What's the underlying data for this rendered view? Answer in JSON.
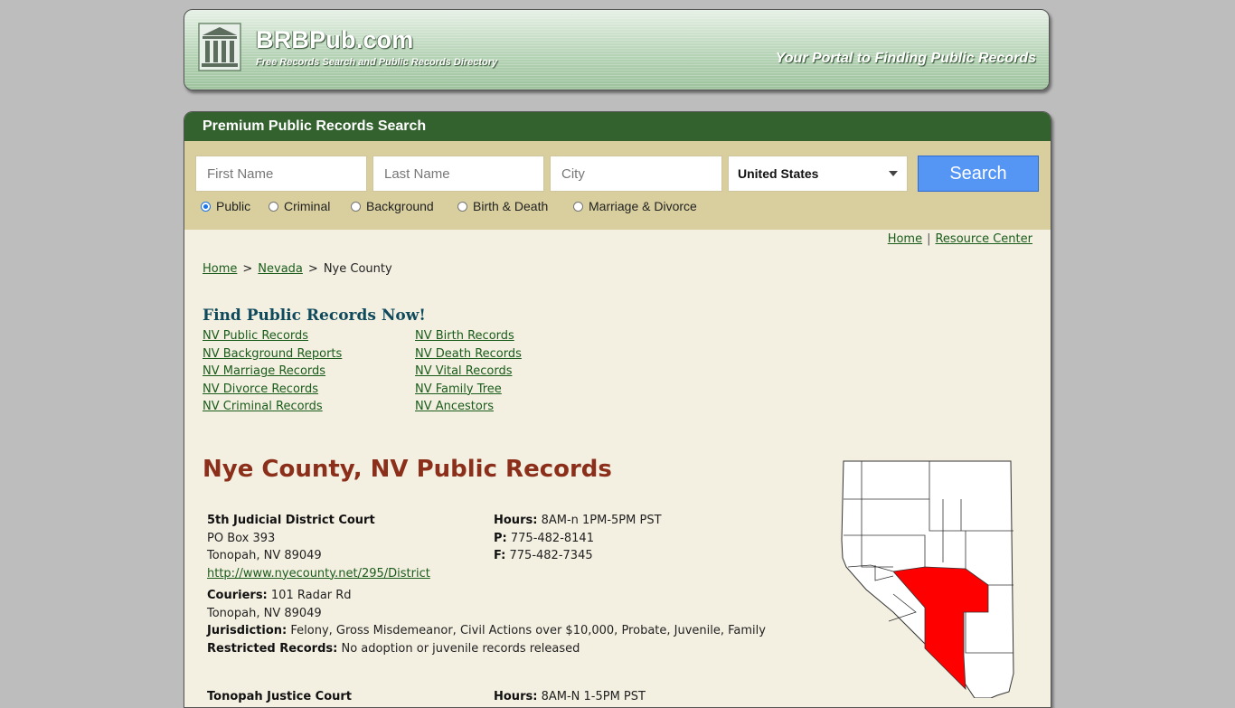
{
  "header": {
    "site_name": "BRBPub.com",
    "tagline": "Free Records Search and Public Records Directory",
    "slogan": "Your Portal to Finding Public Records"
  },
  "search": {
    "title": "Premium Public Records Search",
    "first_name_placeholder": "First Name",
    "last_name_placeholder": "Last Name",
    "city_placeholder": "City",
    "country_selected": "United States",
    "button_label": "Search",
    "record_types": [
      {
        "label": "Public",
        "selected": true
      },
      {
        "label": "Criminal",
        "selected": false
      },
      {
        "label": "Background",
        "selected": false
      },
      {
        "label": "Birth & Death",
        "selected": false
      },
      {
        "label": "Marriage & Divorce",
        "selected": false
      }
    ]
  },
  "top_links": {
    "home": "Home",
    "separator": "|",
    "resource_center": "Resource Center"
  },
  "breadcrumb": {
    "home": "Home",
    "state": "Nevada",
    "current": "Nye County",
    "separator": ">"
  },
  "find_records": {
    "title": "Find Public Records Now!",
    "left_links": [
      "NV Public Records",
      "NV Background Reports",
      "NV Marriage Records",
      "NV Divorce Records",
      "NV Criminal Records"
    ],
    "right_links": [
      "NV Birth Records",
      "NV Death Records",
      "NV Vital Records",
      "NV Family Tree",
      "NV Ancestors"
    ]
  },
  "county": {
    "title": "Nye County, NV Public Records",
    "office": {
      "name": "5th Judicial District Court",
      "address1": "PO Box 393",
      "address2": "Tonopah, NV 89049",
      "url": "http://www.nyecounty.net/295/District",
      "hours_label": "Hours:",
      "hours": "8AM-n 1PM-5PM PST",
      "phone_label": "P:",
      "phone": "775-482-8141",
      "fax_label": "F:",
      "fax": "775-482-7345",
      "couriers_label": "Couriers:",
      "couriers": "101 Radar Rd",
      "couriers_city": "Tonopah, NV 89049",
      "jurisdiction_label": "Jurisdiction:",
      "jurisdiction": "Felony, Gross Misdemeanor, Civil Actions over $10,000, Probate, Juvenile, Family",
      "restricted_label": "Restricted Records:",
      "restricted": "No adoption or juvenile records released"
    },
    "next_office": {
      "name": "Tonopah Justice Court",
      "hours_label": "Hours:",
      "hours": "8AM-N 1-5PM PST"
    },
    "map_highlight_color": "#ff0000"
  }
}
